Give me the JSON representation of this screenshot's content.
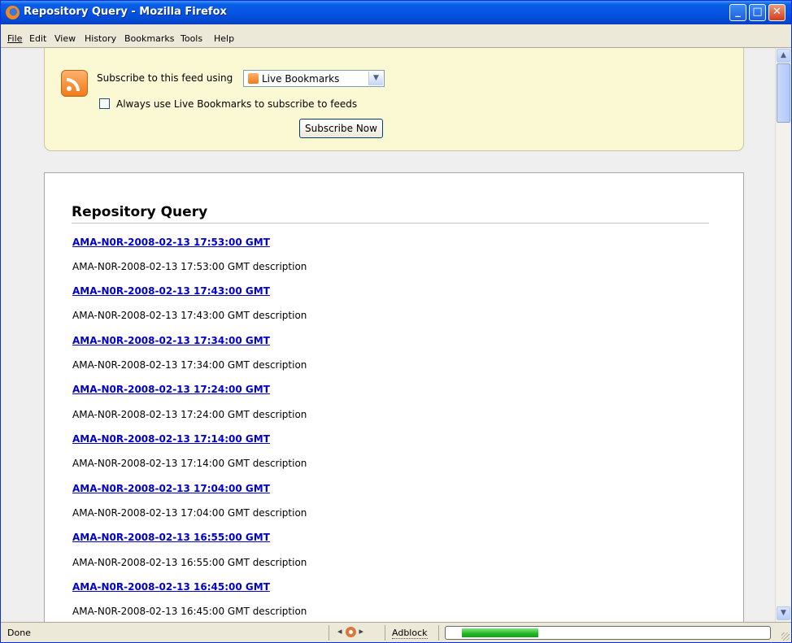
{
  "window": {
    "title": "Repository Query - Mozilla Firefox"
  },
  "menu": [
    "File",
    "Edit",
    "View",
    "History",
    "Bookmarks",
    "Tools",
    "Help"
  ],
  "subscribe": {
    "label": "Subscribe to this feed using",
    "selected": "Live Bookmarks",
    "checkbox_label": "Always use Live Bookmarks to subscribe to feeds",
    "checkbox_checked": false,
    "button": "Subscribe Now"
  },
  "feed": {
    "title": "Repository Query",
    "entries": [
      {
        "link": "AMA-N0R-2008-02-13 17:53:00 GMT",
        "description": "AMA-N0R-2008-02-13 17:53:00 GMT description"
      },
      {
        "link": "AMA-N0R-2008-02-13 17:43:00 GMT",
        "description": "AMA-N0R-2008-02-13 17:43:00 GMT description"
      },
      {
        "link": "AMA-N0R-2008-02-13 17:34:00 GMT",
        "description": "AMA-N0R-2008-02-13 17:34:00 GMT description"
      },
      {
        "link": "AMA-N0R-2008-02-13 17:24:00 GMT",
        "description": "AMA-N0R-2008-02-13 17:24:00 GMT description"
      },
      {
        "link": "AMA-N0R-2008-02-13 17:14:00 GMT",
        "description": "AMA-N0R-2008-02-13 17:14:00 GMT description"
      },
      {
        "link": "AMA-N0R-2008-02-13 17:04:00 GMT",
        "description": "AMA-N0R-2008-02-13 17:04:00 GMT description"
      },
      {
        "link": "AMA-N0R-2008-02-13 16:55:00 GMT",
        "description": "AMA-N0R-2008-02-13 16:55:00 GMT description"
      },
      {
        "link": "AMA-N0R-2008-02-13 16:45:00 GMT",
        "description": "AMA-N0R-2008-02-13 16:45:00 GMT description"
      }
    ]
  },
  "status": {
    "text": "Done",
    "adblock": "Adblock",
    "progress": 0.25
  },
  "colors": {
    "link": "#0000cc",
    "feed_banner": "#fbf9d3",
    "titlebar": "#0554e3",
    "progress": "#22b524"
  },
  "icons": {
    "title": "firefox-icon",
    "feed": "rss-feed-icon",
    "status": "cd-icon"
  }
}
